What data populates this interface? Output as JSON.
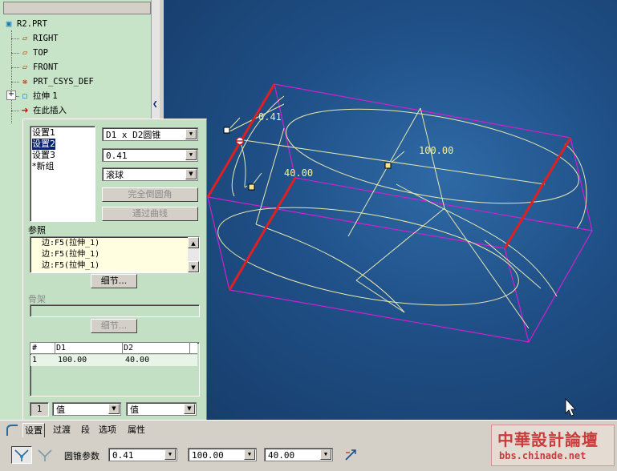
{
  "tree": {
    "items": [
      {
        "label": "R2.PRT",
        "icon": "part-icon"
      },
      {
        "label": "RIGHT",
        "icon": "datum-plane-icon"
      },
      {
        "label": "TOP",
        "icon": "datum-plane-icon"
      },
      {
        "label": "FRONT",
        "icon": "datum-plane-icon"
      },
      {
        "label": "PRT_CSYS_DEF",
        "icon": "csys-icon"
      },
      {
        "label": "拉伸 1",
        "icon": "extrude-icon"
      },
      {
        "label": "在此插入",
        "icon": "insert-here-arrow-icon"
      }
    ],
    "expand_glyph": "+"
  },
  "panel": {
    "sets": [
      "设置1",
      "设置2",
      "设置3",
      "*新组"
    ],
    "selected_set": 1,
    "shape_combo": "D1 x D2圆锥",
    "value_combo": "0.41",
    "method_combo": "滚球",
    "full_round_button": "完全倒圆角",
    "through_curve_button": "通过曲线",
    "references_label": "参照",
    "references": [
      "边:F5(拉伸_1)",
      "边:F5(拉伸_1)",
      "边:F5(拉伸_1)"
    ],
    "details_button": "细节...",
    "spine_label": "骨架",
    "spine_details_button": "细节...",
    "table_headers": [
      "#",
      "D1",
      "D2"
    ],
    "table_rows": [
      [
        "1",
        "100.00",
        "40.00"
      ]
    ],
    "row_number": "1",
    "value_select_1": "值",
    "value_select_2": "值"
  },
  "viewport": {
    "label_rho": "0.41",
    "label_d1": "100.00",
    "label_d2": "40.00"
  },
  "dashboard": {
    "tabs": [
      "设置",
      "过渡",
      "段",
      "选项",
      "属性"
    ],
    "active_tab": 0,
    "conic_param_label": "圆锥参数",
    "conic_value": "0.41",
    "d1_value": "100.00",
    "d2_value": "40.00"
  },
  "watermark": {
    "title": "中華設計論壇",
    "url": "bbs.chinade.net"
  },
  "colors": {
    "viewport_bg": "#1f4f86",
    "tree_bg": "#c8e4c8",
    "edge_highlight": "#e02020",
    "bounding_lines": "#d020d0",
    "wire": "#e8e8b0",
    "watermark_red": "#c83c3c"
  }
}
